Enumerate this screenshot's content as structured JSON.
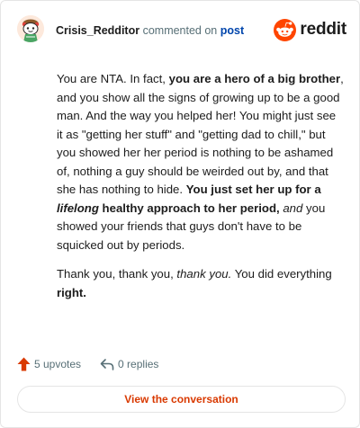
{
  "header": {
    "username": "Crisis_Redditor",
    "commented_on": "commented on",
    "post_link": "post",
    "brand_wordmark": "reddit",
    "avatar_icon": "snoo-avatar-icon",
    "logo_icon": "reddit-snoo-logo-icon",
    "brand_color": "#ff4500"
  },
  "comment": {
    "p1": {
      "t1": "You are NTA. In fact, ",
      "b1": "you are a hero of a big brother",
      "t2": ", and you show all the signs of growing up to be a good man. And the way you helped her! You might just see it as \"getting her stuff\" and \"getting dad to chill,\" but you showed her her period is nothing to be ashamed of, nothing a guy should be weirded out by, and that she has nothing to hide. ",
      "b2": "You just set her up for a ",
      "bi": "lifelong",
      "b3": " healthy approach to her period,",
      "t3": " ",
      "i1": "and",
      "t4": " you showed your friends that guys don't have to be squicked out by periods."
    },
    "p2": {
      "t1": "Thank you, thank you, ",
      "i1": "thank you.",
      "t2": " You did everything ",
      "b1": "right."
    }
  },
  "actions": {
    "upvotes": "5 upvotes",
    "replies": "0 replies",
    "upvote_icon": "upvote-arrow-icon",
    "reply_icon": "reply-arrow-icon",
    "upvote_color": "#d93900"
  },
  "footer": {
    "view_button": "View the conversation"
  }
}
